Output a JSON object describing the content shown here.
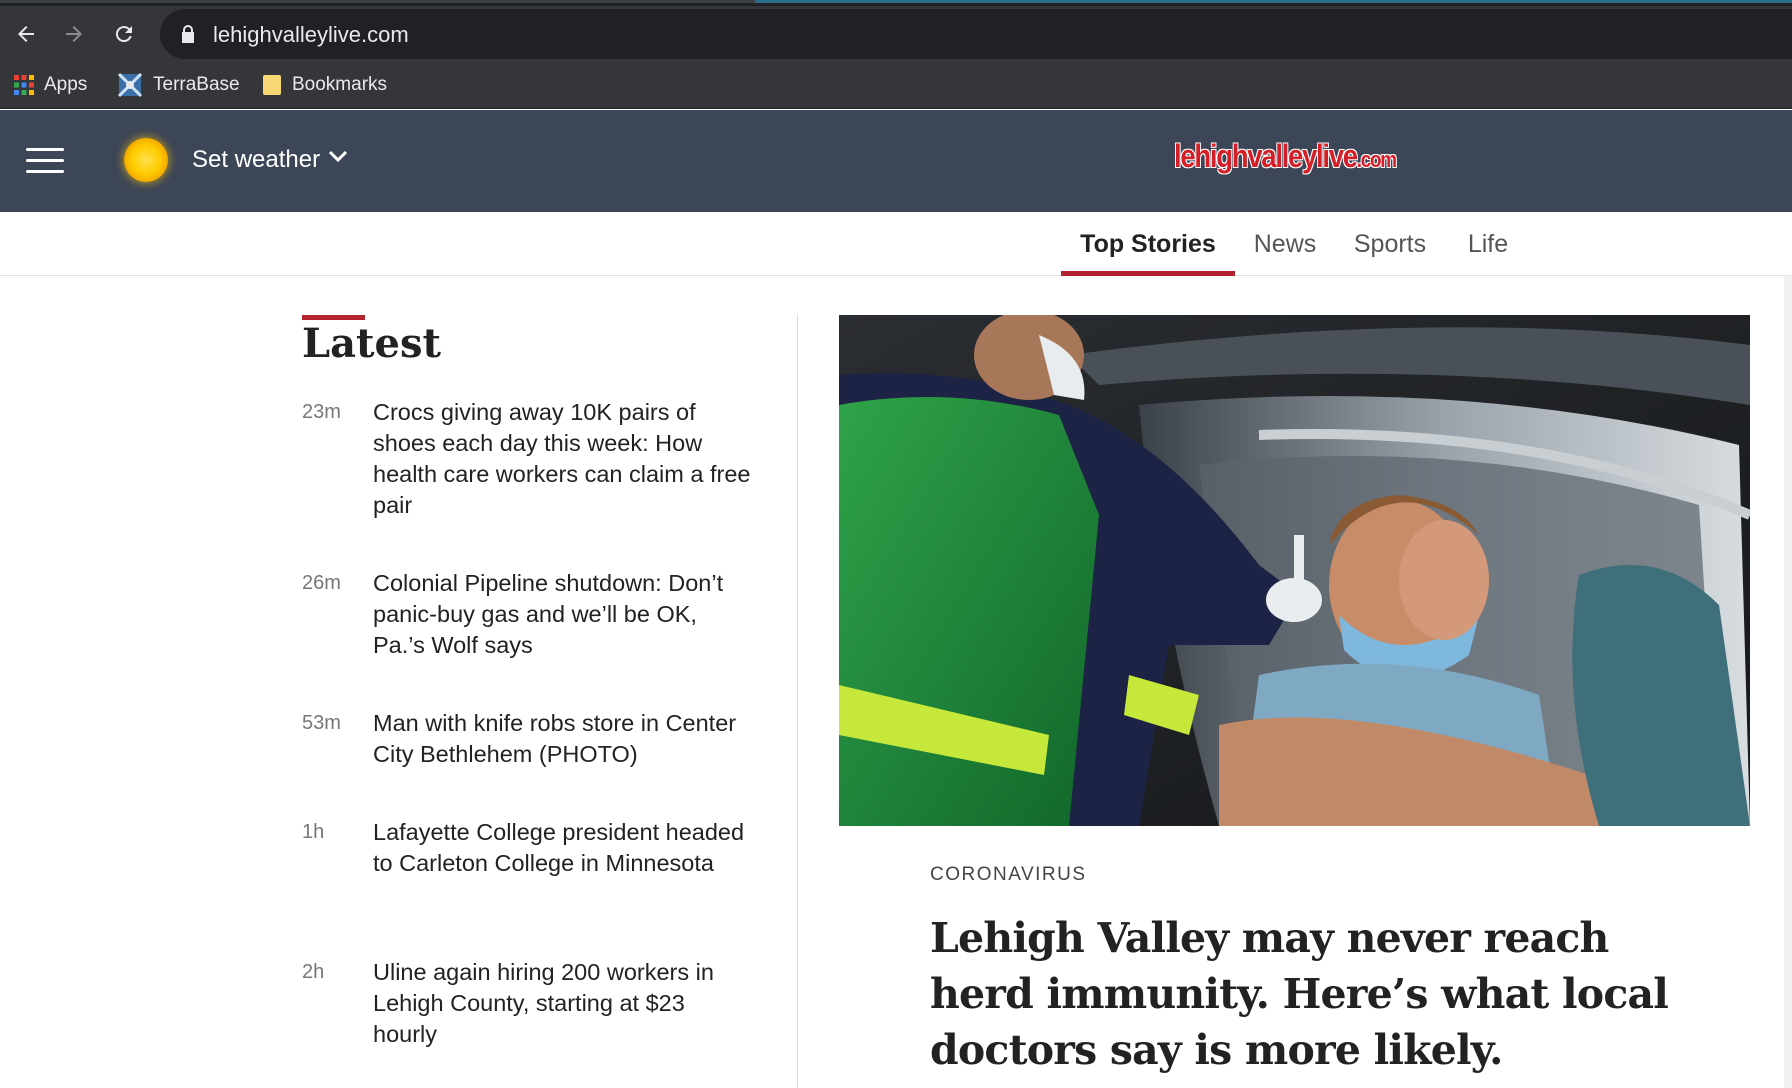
{
  "browser": {
    "url": "lehighvalleylive.com",
    "bookmarks": [
      {
        "label": "Apps",
        "icon": "apps-grid-icon"
      },
      {
        "label": "TerraBase",
        "icon": "terrabase-icon"
      },
      {
        "label": "Bookmarks",
        "icon": "folder-icon"
      }
    ]
  },
  "header": {
    "weather_label": "Set weather",
    "logo_main": "lehighvalleylive",
    "logo_suffix": ".com"
  },
  "section_nav": {
    "tabs": [
      {
        "label": "Top Stories",
        "active": true
      },
      {
        "label": "News",
        "active": false
      },
      {
        "label": "Sports",
        "active": false
      },
      {
        "label": "Life",
        "active": false
      }
    ]
  },
  "latest": {
    "title": "Latest",
    "stories": [
      {
        "time": "23m",
        "headline": "Crocs giving away 10K pairs of shoes each day this week: How health care workers can claim a free pair"
      },
      {
        "time": "26m",
        "headline": "Colonial Pipeline shutdown: Don’t panic-buy gas and we’ll be OK, Pa.’s Wolf says"
      },
      {
        "time": "53m",
        "headline": "Man with knife robs store in Center City Bethlehem (PHOTO)"
      },
      {
        "time": "1h",
        "headline": "Lafayette College president headed to Carleton College in Minnesota"
      },
      {
        "time": "2h",
        "headline": "Uline again hiring 200 workers in Lehigh County, starting at $23 hourly"
      }
    ]
  },
  "feature": {
    "kicker": "CORONAVIRUS",
    "headline": "Lehigh Valley may never reach herd immunity. Here’s what local doctors say is more likely."
  },
  "colors": {
    "header_bg": "#3d4657",
    "accent_red": "#b3232d",
    "logo_red": "#d41f28",
    "browser_dark": "#35363a"
  }
}
